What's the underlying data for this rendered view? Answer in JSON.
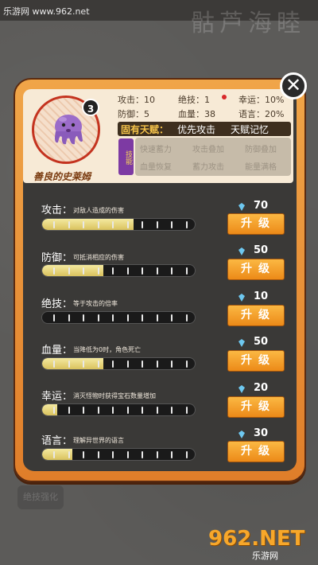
{
  "watermark": {
    "top_text": "乐游网 www.962.net",
    "logo_main": "962.NET",
    "logo_sub": "乐游网"
  },
  "background": {
    "title": "骷芦海睦",
    "ghost_button": "绝技强化"
  },
  "hero": {
    "level": "3",
    "name": "善良的史莱姆"
  },
  "stats": {
    "attack": "攻击：10",
    "skill": "绝技：1",
    "luck": "幸运：10%",
    "defense": "防御：5",
    "hp": "血量：38",
    "language": "语言：20%"
  },
  "talent": {
    "label": "固有天赋：",
    "a": "优先攻击",
    "b": "天赋记忆"
  },
  "skill_tag": "技能",
  "skills": [
    "快速蓄力",
    "攻击叠加",
    "防御叠加",
    "血量恢复",
    "蓄力攻击",
    "能量满格"
  ],
  "close_label": "✕",
  "upgrade_label": "升级",
  "rows": [
    {
      "label": "攻击：",
      "desc": "对敌人造成的伤害",
      "cost": "70",
      "fill": 0.6
    },
    {
      "label": "防御：",
      "desc": "可抵消相应的伤害",
      "cost": "50",
      "fill": 0.4
    },
    {
      "label": "绝技：",
      "desc": "等于攻击的倍率",
      "cost": "10",
      "fill": 0.0
    },
    {
      "label": "血量：",
      "desc": "当降低为0时，角色死亡",
      "cost": "50",
      "fill": 0.4
    },
    {
      "label": "幸运：",
      "desc": "消灭怪物时获得宝石数量增加",
      "cost": "20",
      "fill": 0.1
    },
    {
      "label": "语言：",
      "desc": "理解异世界的语言",
      "cost": "30",
      "fill": 0.2
    }
  ],
  "colors": {
    "panel": "#e8902f",
    "gem": "#6ec8f0",
    "upgrade": "#f2a02a",
    "bar_fill": "#e6d477"
  }
}
